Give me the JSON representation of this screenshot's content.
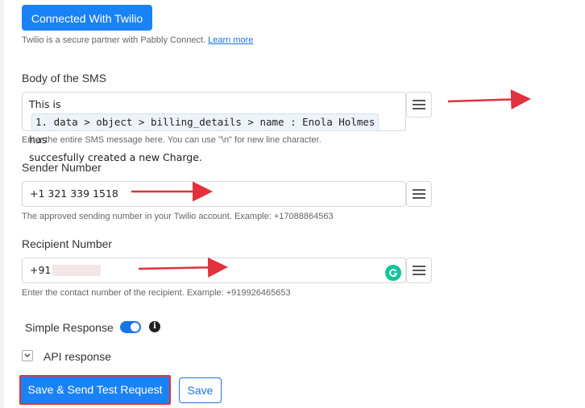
{
  "header": {
    "connected_button": "Connected With Twilio",
    "partner_text": "Twilio is a secure partner with Pabbly Connect.",
    "learn_more": "Learn more"
  },
  "body_sms": {
    "label": "Body of the SMS",
    "prefix": "This is",
    "chip": "1. data > object > billing_details > name : Enola Holmes",
    "suffix": "has",
    "line2": "succesfully created a new Charge.",
    "help": "Enter the entire SMS message here. You can use \"\\n\" for new line character."
  },
  "sender": {
    "label": "Sender Number",
    "value": "+1 321 339 1518",
    "help": "The approved sending number in your Twilio account. Example: +17088864563"
  },
  "recipient": {
    "label": "Recipient Number",
    "value": "+91",
    "help": "Enter the contact number of the recipient. Example: +919926465653"
  },
  "simple_response": {
    "label": "Simple Response",
    "enabled": true
  },
  "api_response": {
    "label": "API response"
  },
  "actions": {
    "save_test": "Save & Send Test Request",
    "save": "Save"
  },
  "colors": {
    "accent": "#1a82f7",
    "annotation_red": "#e1313c",
    "grammarly": "#15c39a"
  }
}
